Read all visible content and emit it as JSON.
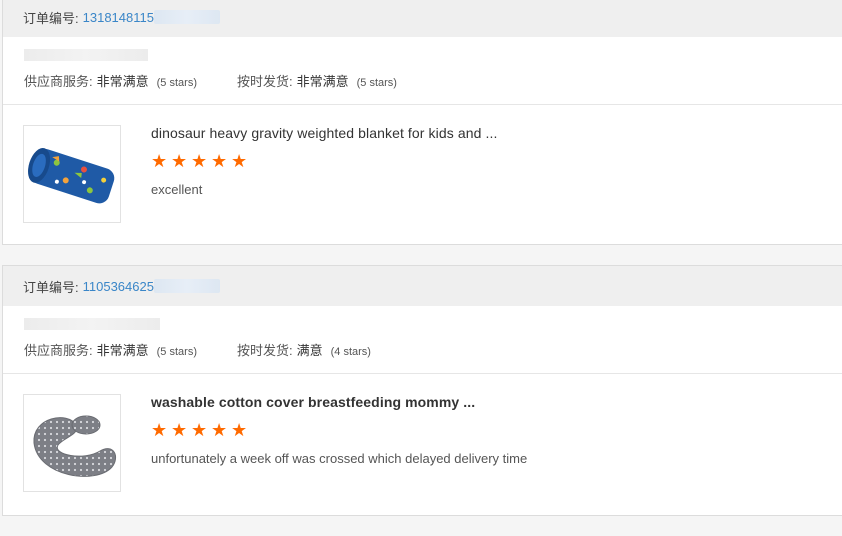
{
  "orders": [
    {
      "order_label": "订单编号:",
      "order_number": "1318148115",
      "supplier_service_label": "供应商服务:",
      "supplier_service_value": "非常满意",
      "supplier_service_stars": "(5 stars)",
      "shipping_label": "按时发货:",
      "shipping_value": "非常满意",
      "shipping_stars": "(5 stars)",
      "item": {
        "title": "dinosaur heavy gravity weighted blanket for kids and ...",
        "rating": 5,
        "comment": "excellent",
        "image_icon": "rolled-dinosaur-blanket-image"
      }
    },
    {
      "order_label": "订单编号:",
      "order_number": "1105364625",
      "supplier_service_label": "供应商服务:",
      "supplier_service_value": "非常满意",
      "supplier_service_stars": "(5 stars)",
      "shipping_label": "按时发货:",
      "shipping_value": "满意",
      "shipping_stars": "(4 stars)",
      "item": {
        "title": "washable cotton cover breastfeeding mommy ...",
        "rating": 5,
        "comment": "unfortunately a week off was crossed which delayed delivery time",
        "image_icon": "nursing-pillow-image"
      }
    }
  ],
  "colors": {
    "star": "#ff6a00",
    "order_number": "#3a86c8",
    "header_bg": "#efefef"
  }
}
